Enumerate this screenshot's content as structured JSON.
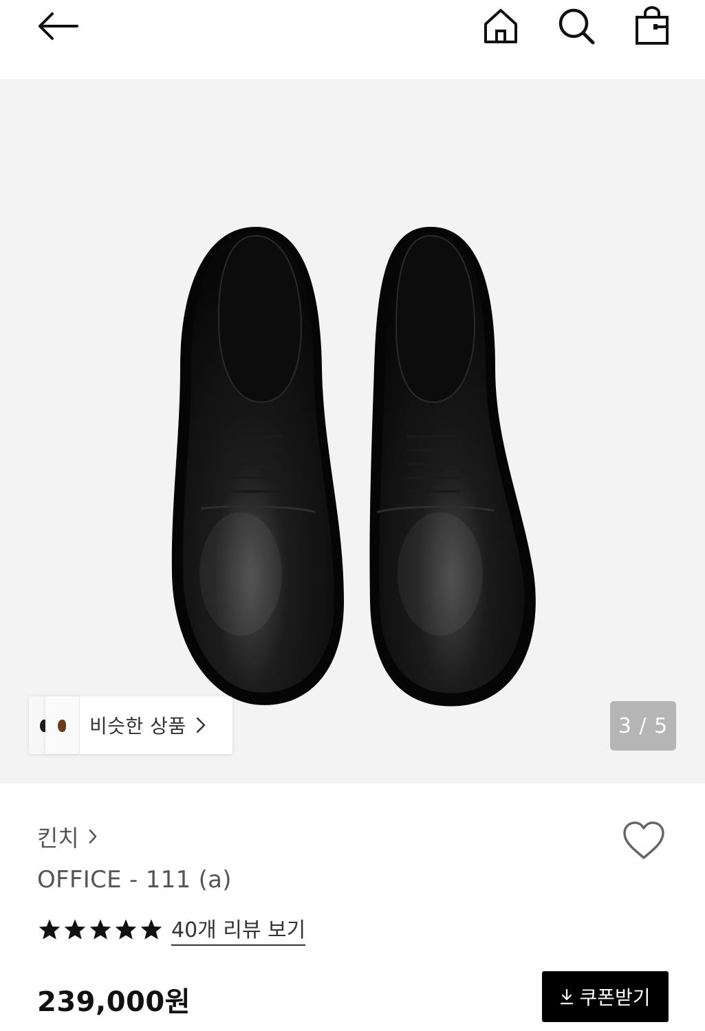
{
  "header": {
    "back_icon": "arrow-left-icon",
    "home_icon": "home-icon",
    "search_icon": "search-icon",
    "cart_icon": "shopping-bag-icon"
  },
  "gallery": {
    "similar_label": "비슷한 상품",
    "page_counter": "3 / 5",
    "current_page": 3,
    "total_pages": 5
  },
  "product": {
    "brand": "킨치",
    "title": "OFFICE - 111 (a)",
    "rating_stars": 5,
    "review_link": "40개 리뷰 보기",
    "price": "239,000원",
    "coupon_label": "쿠폰받기"
  },
  "colors": {
    "accent": "#000000",
    "gallery_bg": "#f3f3f3",
    "counter_bg": "#b5b5b5"
  }
}
